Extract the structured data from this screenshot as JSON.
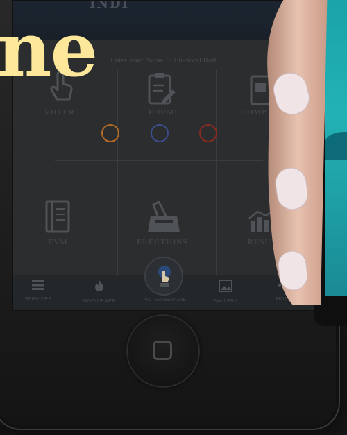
{
  "headline": "ne",
  "app": {
    "header_title": "INDI",
    "notice": "Enter Your Name In Electoral Roll",
    "tiles": [
      {
        "label": "VOTER",
        "icon": "hand-pointer-icon"
      },
      {
        "label": "FORMS",
        "icon": "clipboard-icon"
      },
      {
        "label": "COMP",
        "icon": "document-icon"
      },
      {
        "label": "EVM",
        "icon": "notebook-icon"
      },
      {
        "label": "ELECTIONS",
        "icon": "ballot-box-icon"
      },
      {
        "label": "RESU",
        "icon": "bar-chart-icon"
      }
    ],
    "dots": [
      {
        "color": "#b46a26"
      },
      {
        "color": "#3c4d8c"
      },
      {
        "color": "#8a2a22"
      }
    ],
    "bottom_bar": [
      {
        "label": "SERVICES",
        "icon": "menu-icon"
      },
      {
        "label": "MOBILE APP",
        "icon": "flame-icon"
      },
      {
        "label": "GALLERY",
        "icon": "image-icon"
      },
      {
        "label": "MORE",
        "icon": "more-icon"
      }
    ],
    "center_button": {
      "label": "VOTER HELPLINE",
      "icon": "finger-vote-icon"
    }
  },
  "colors": {
    "headline": "#fce79a",
    "second_phone_screen": "#1aa2a8"
  }
}
